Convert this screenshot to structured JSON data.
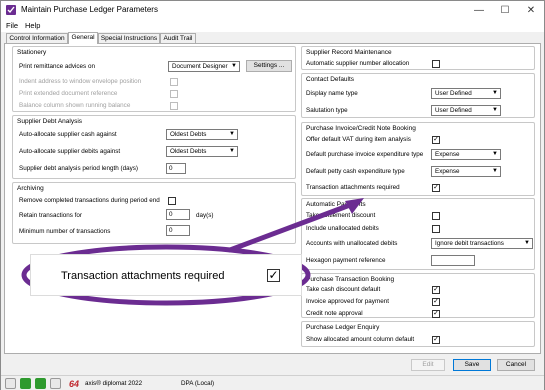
{
  "window": {
    "title": "Maintain Purchase Ledger Parameters",
    "minimize": "—",
    "maximize": "☐",
    "close": "✕"
  },
  "menu": [
    "File",
    "Help"
  ],
  "tabs": [
    {
      "label": "Control Information"
    },
    {
      "label": "General"
    },
    {
      "label": "Special Instructions"
    },
    {
      "label": "Audit Trail"
    }
  ],
  "active_tab": "General",
  "stationery": {
    "title": "Stationery",
    "print_remittance_label": "Print remittance advices on",
    "print_remittance_value": "Document Designer",
    "settings_button": "Settings ...",
    "indent_label": "Indent address to window envelope position",
    "print_extended_label": "Print extended document reference",
    "balance_column_label": "Balance column shown running balance"
  },
  "supplier_debt": {
    "title": "Supplier Debt Analysis",
    "cash_label": "Auto-allocate supplier cash against",
    "cash_value": "Oldest Debts",
    "debits_label": "Auto-allocate supplier debits against",
    "debits_value": "Oldest Debts",
    "period_label": "Supplier debt analysis period length (days)",
    "period_value": "0"
  },
  "archiving": {
    "title": "Archiving",
    "remove_label": "Remove completed transactions during period end",
    "retain_label": "Retain transactions for",
    "retain_value": "0",
    "retain_unit": "day(s)",
    "min_label": "Minimum number of transactions",
    "min_value": "0"
  },
  "supplier_record": {
    "title": "Supplier Record Maintenance",
    "auto_number_label": "Automatic supplier number allocation"
  },
  "contact_defaults": {
    "title": "Contact Defaults",
    "display_name_label": "Display name type",
    "display_name_value": "User Defined",
    "salutation_label": "Salutation type",
    "salutation_value": "User Defined"
  },
  "invoice_booking": {
    "title": "Purchase Invoice/Credit Note Booking",
    "vat_label": "Offer default VAT during item analysis",
    "vat_checked": "✓",
    "expenditure_label": "Default purchase invoice expenditure type",
    "expenditure_value": "Expense",
    "petty_cash_label": "Default petty cash expenditure type",
    "petty_cash_value": "Expense",
    "attachments_label": "Transaction attachments required",
    "attachments_checked": "✓"
  },
  "automatic_payments": {
    "title": "Automatic Payments",
    "settlement_label": "Take settlement discount",
    "unallocated_label": "Include unallocated debits",
    "accounts_label": "Accounts with unallocated debits",
    "accounts_value": "Ignore debit transactions",
    "hexagon_label": "Hexagon payment reference"
  },
  "transaction_booking": {
    "title": "Purchase Transaction Booking",
    "cash_discount_label": "Take cash discount default",
    "cash_discount_checked": "✓",
    "invoice_approved_label": "Invoice approved for payment",
    "invoice_approved_checked": "✓",
    "credit_note_label": "Credit note approval",
    "credit_note_checked": "✓"
  },
  "ledger_enquiry": {
    "title": "Purchase Ledger Enquiry",
    "show_allocated_label": "Show allocated amount column default",
    "show_allocated_checked": "✓"
  },
  "footer": {
    "edit": "Edit",
    "save": "Save",
    "cancel": "Cancel"
  },
  "callout": {
    "text": "Transaction attachments required",
    "checked": "✓",
    "accent": "#6b2c91"
  },
  "statusbar": {
    "product": "axis® diplomat 2022",
    "dpa": "DPA (Local)"
  },
  "colors": {
    "accent_purple": "#6b2c91",
    "status_green": "#2e9a2e",
    "primary_blue": "#0078d7"
  }
}
